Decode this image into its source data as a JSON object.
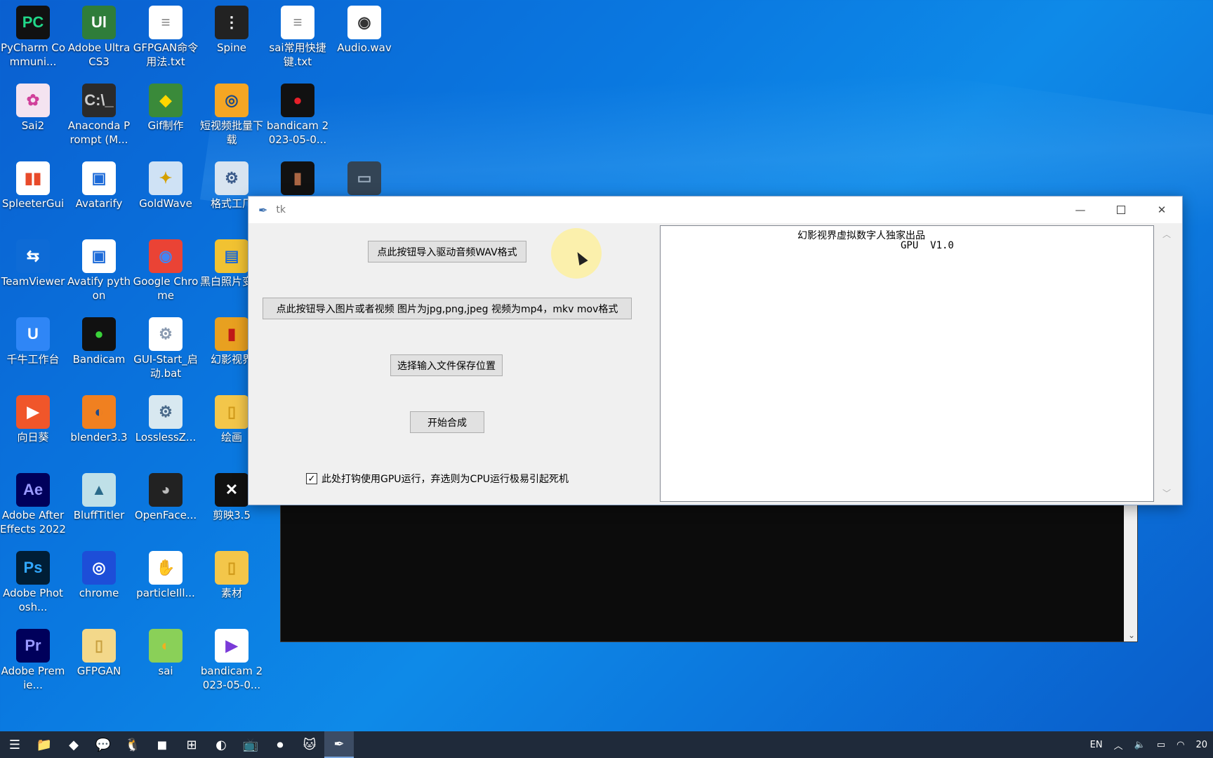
{
  "desktop": {
    "icons": [
      {
        "label": "PyCharm Communi...",
        "glyph": "PC",
        "bg": "#111111",
        "fg": "#21d789"
      },
      {
        "label": "Adobe Ultra CS3",
        "glyph": "Ul",
        "bg": "#2f7d3a",
        "fg": "#ffffff"
      },
      {
        "label": "GFPGAN命令用法.txt",
        "glyph": "≡",
        "bg": "#ffffff",
        "fg": "#888888"
      },
      {
        "label": "Spine",
        "glyph": "⋮",
        "bg": "#222222",
        "fg": "#ffffff"
      },
      {
        "label": "sai常用快捷键.txt",
        "glyph": "≡",
        "bg": "#ffffff",
        "fg": "#888888"
      },
      {
        "label": "Audio.wav",
        "glyph": "◉",
        "bg": "#ffffff",
        "fg": "#333333"
      },
      {
        "label": "Sai2",
        "glyph": "✿",
        "bg": "#f4e3f0",
        "fg": "#d0409a"
      },
      {
        "label": "Anaconda Prompt (M...",
        "glyph": "C:\\_",
        "bg": "#2b2b2b",
        "fg": "#cccccc"
      },
      {
        "label": "Gif制作",
        "glyph": "◆",
        "bg": "#3a8a3a",
        "fg": "#ffd700"
      },
      {
        "label": "短视频批量下载",
        "glyph": "◎",
        "bg": "#f5a623",
        "fg": "#1a4a8a"
      },
      {
        "label": "bandicam 2023-05-0...",
        "glyph": "●",
        "bg": "#111111",
        "fg": "#e8202a"
      },
      {
        "label": "SpleeterGui",
        "glyph": "▮▮",
        "bg": "#ffffff",
        "fg": "#e84a2a"
      },
      {
        "label": "Avatarify",
        "glyph": "▣",
        "bg": "#ffffff",
        "fg": "#1c6ad8"
      },
      {
        "label": "GoldWave",
        "glyph": "✦",
        "bg": "#cfe2f5",
        "fg": "#d4a000"
      },
      {
        "label": "格式工厂",
        "glyph": "⚙",
        "bg": "#d8e4f0",
        "fg": "#3a5a8a"
      },
      {
        "label": "TeamViewer",
        "glyph": "⇆",
        "bg": "#0e6bd6",
        "fg": "#ffffff"
      },
      {
        "label": "Avatify python",
        "glyph": "▣",
        "bg": "#ffffff",
        "fg": "#1c6ad8"
      },
      {
        "label": "Google Chrome",
        "glyph": "◉",
        "bg": "#ea4335",
        "fg": "#4285f4"
      },
      {
        "label": "黑白照片变色",
        "glyph": "▤",
        "bg": "#f1c232",
        "fg": "#1c6ad8"
      },
      {
        "label": "千牛工作台",
        "glyph": "U",
        "bg": "#2f86f6",
        "fg": "#ffffff"
      },
      {
        "label": "Bandicam",
        "glyph": "●",
        "bg": "#111111",
        "fg": "#3ad23a"
      },
      {
        "label": "GUI-Start_启动.bat",
        "glyph": "⚙",
        "bg": "#ffffff",
        "fg": "#8a9ab0"
      },
      {
        "label": "幻影视界",
        "glyph": "▮",
        "bg": "#e8a020",
        "fg": "#c01818"
      },
      {
        "label": "向日葵",
        "glyph": "▶",
        "bg": "#f0562a",
        "fg": "#ffffff"
      },
      {
        "label": "blender3.3",
        "glyph": "◐",
        "bg": "#f08020",
        "fg": "#1e4a8a"
      },
      {
        "label": "LosslessZ...",
        "glyph": "⚙",
        "bg": "#d8e8f0",
        "fg": "#4a6a8a"
      },
      {
        "label": "绘画",
        "glyph": "▯",
        "bg": "#f3c64a",
        "fg": "#d09a1a"
      },
      {
        "label": "Adobe After Effects 2022",
        "glyph": "Ae",
        "bg": "#00005b",
        "fg": "#9999ff"
      },
      {
        "label": "BluffTitler",
        "glyph": "▲",
        "bg": "#bfe0e8",
        "fg": "#2a6a8a"
      },
      {
        "label": "OpenFace...",
        "glyph": "◕",
        "bg": "#222222",
        "fg": "#bbbbbb"
      },
      {
        "label": "剪映3.5",
        "glyph": "✕",
        "bg": "#111111",
        "fg": "#ffffff"
      },
      {
        "label": "Adobe Photosh...",
        "glyph": "Ps",
        "bg": "#001e36",
        "fg": "#31a8ff"
      },
      {
        "label": "chrome",
        "glyph": "◎",
        "bg": "#1d4ed8",
        "fg": "#ffffff"
      },
      {
        "label": "particleIll...",
        "glyph": "✋",
        "bg": "#ffffff",
        "fg": "#1a8a1a"
      },
      {
        "label": "素材",
        "glyph": "▯",
        "bg": "#f3c64a",
        "fg": "#d09a1a"
      },
      {
        "label": "Adobe Premie...",
        "glyph": "Pr",
        "bg": "#00005b",
        "fg": "#9999ff"
      },
      {
        "label": "GFPGAN",
        "glyph": "▯",
        "bg": "#f3d88a",
        "fg": "#c8a040"
      },
      {
        "label": "sai",
        "glyph": "◐",
        "bg": "#8ad058",
        "fg": "#f0b020"
      },
      {
        "label": "bandicam 2023-05-0...",
        "glyph": "▶",
        "bg": "#ffffff",
        "fg": "#7a3ad8"
      },
      {
        "label": "",
        "glyph": "▮",
        "bg": "#111111",
        "fg": "#aa6644"
      },
      {
        "label": "",
        "glyph": "▭",
        "bg": "#334455",
        "fg": "#99aabb"
      }
    ]
  },
  "tk_window": {
    "title": "tk",
    "btn_audio": "点此按钮导入驱动音频WAV格式",
    "btn_media": "点此按钮导入图片或者视频 图片为jpg,png,jpeg 视频为mp4，mkv mov格式",
    "btn_save": "选择输入文件保存位置",
    "btn_start": "开始合成",
    "gpu_checkbox_label": "此处打钩使用GPU运行，弃选则为CPU运行极易引起死机",
    "gpu_checked": true,
    "text_line1": "幻影视界虚拟数字人独家出品",
    "text_line2": "GPU  V1.0"
  },
  "taskbar": {
    "items": [
      "☰",
      "📁",
      "◆",
      "💬",
      "🐧",
      "◼",
      "⊞",
      "◐",
      "📺",
      "⏺",
      "🐱",
      "✒"
    ],
    "lang": "EN",
    "clock": "20"
  }
}
